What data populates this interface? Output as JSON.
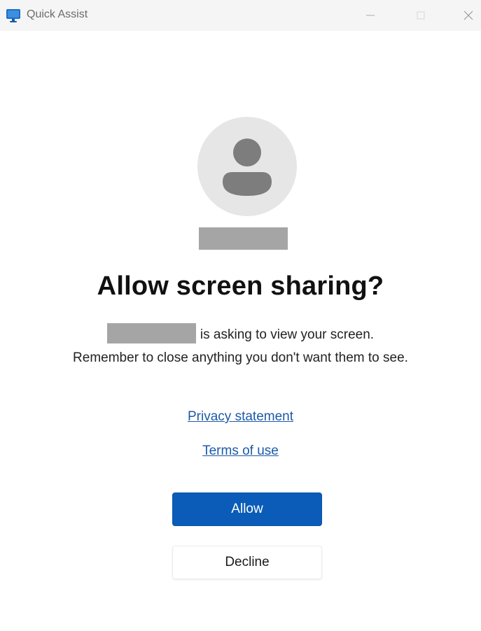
{
  "window": {
    "title": "Quick Assist",
    "icon": "quick-assist-monitor-icon",
    "controls": [
      "minimize-icon",
      "maximize-icon",
      "close-icon"
    ]
  },
  "dialog": {
    "avatar_icon": "person-icon",
    "heading": "Allow screen sharing?",
    "message_line1": "is asking to view your screen.",
    "message_rest": "Remember to close anything you don't want them to see.",
    "privacy_link": "Privacy statement",
    "terms_link": "Terms of use",
    "allow_label": "Allow",
    "decline_label": "Decline"
  },
  "colors": {
    "accent": "#0a5cb8",
    "link": "#1d5aa8",
    "redaction": "#a5a5a5"
  }
}
